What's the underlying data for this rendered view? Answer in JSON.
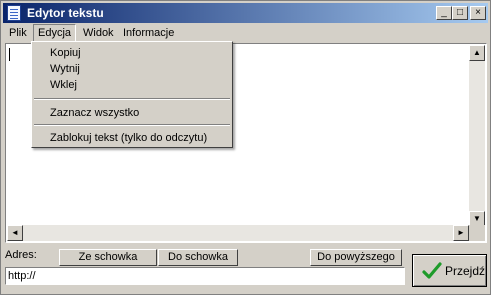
{
  "window": {
    "title": "Edytor tekstu",
    "controls": {
      "minimize": "_",
      "maximize": "□",
      "close": "×"
    }
  },
  "menubar": {
    "items": [
      {
        "label": "Plik"
      },
      {
        "label": "Edycja"
      },
      {
        "label": "Widok"
      },
      {
        "label": "Informacje"
      }
    ]
  },
  "edit_menu": {
    "items": [
      {
        "label": "Kopiuj"
      },
      {
        "label": "Wytnij"
      },
      {
        "label": "Wklej"
      },
      {
        "label": "Zaznacz wszystko"
      },
      {
        "label": "Zablokuj tekst (tylko do odczytu)"
      }
    ]
  },
  "editor": {
    "text": ""
  },
  "address_bar": {
    "label": "Adres:",
    "value": "http://",
    "buttons": {
      "from_clipboard": "Ze schowka",
      "to_clipboard": "Do schowka",
      "to_above": "Do powyższego",
      "go": "Przejdź"
    }
  },
  "colors": {
    "title_start": "#0a246a",
    "title_end": "#a6caf0",
    "face": "#d4d0c8",
    "go_check": "#1e9b2a"
  },
  "icons": [
    "app-icon",
    "minimize-icon",
    "maximize-icon",
    "close-icon",
    "scroll-up-icon",
    "scroll-down-icon",
    "scroll-left-icon",
    "scroll-right-icon",
    "checkmark-icon"
  ]
}
